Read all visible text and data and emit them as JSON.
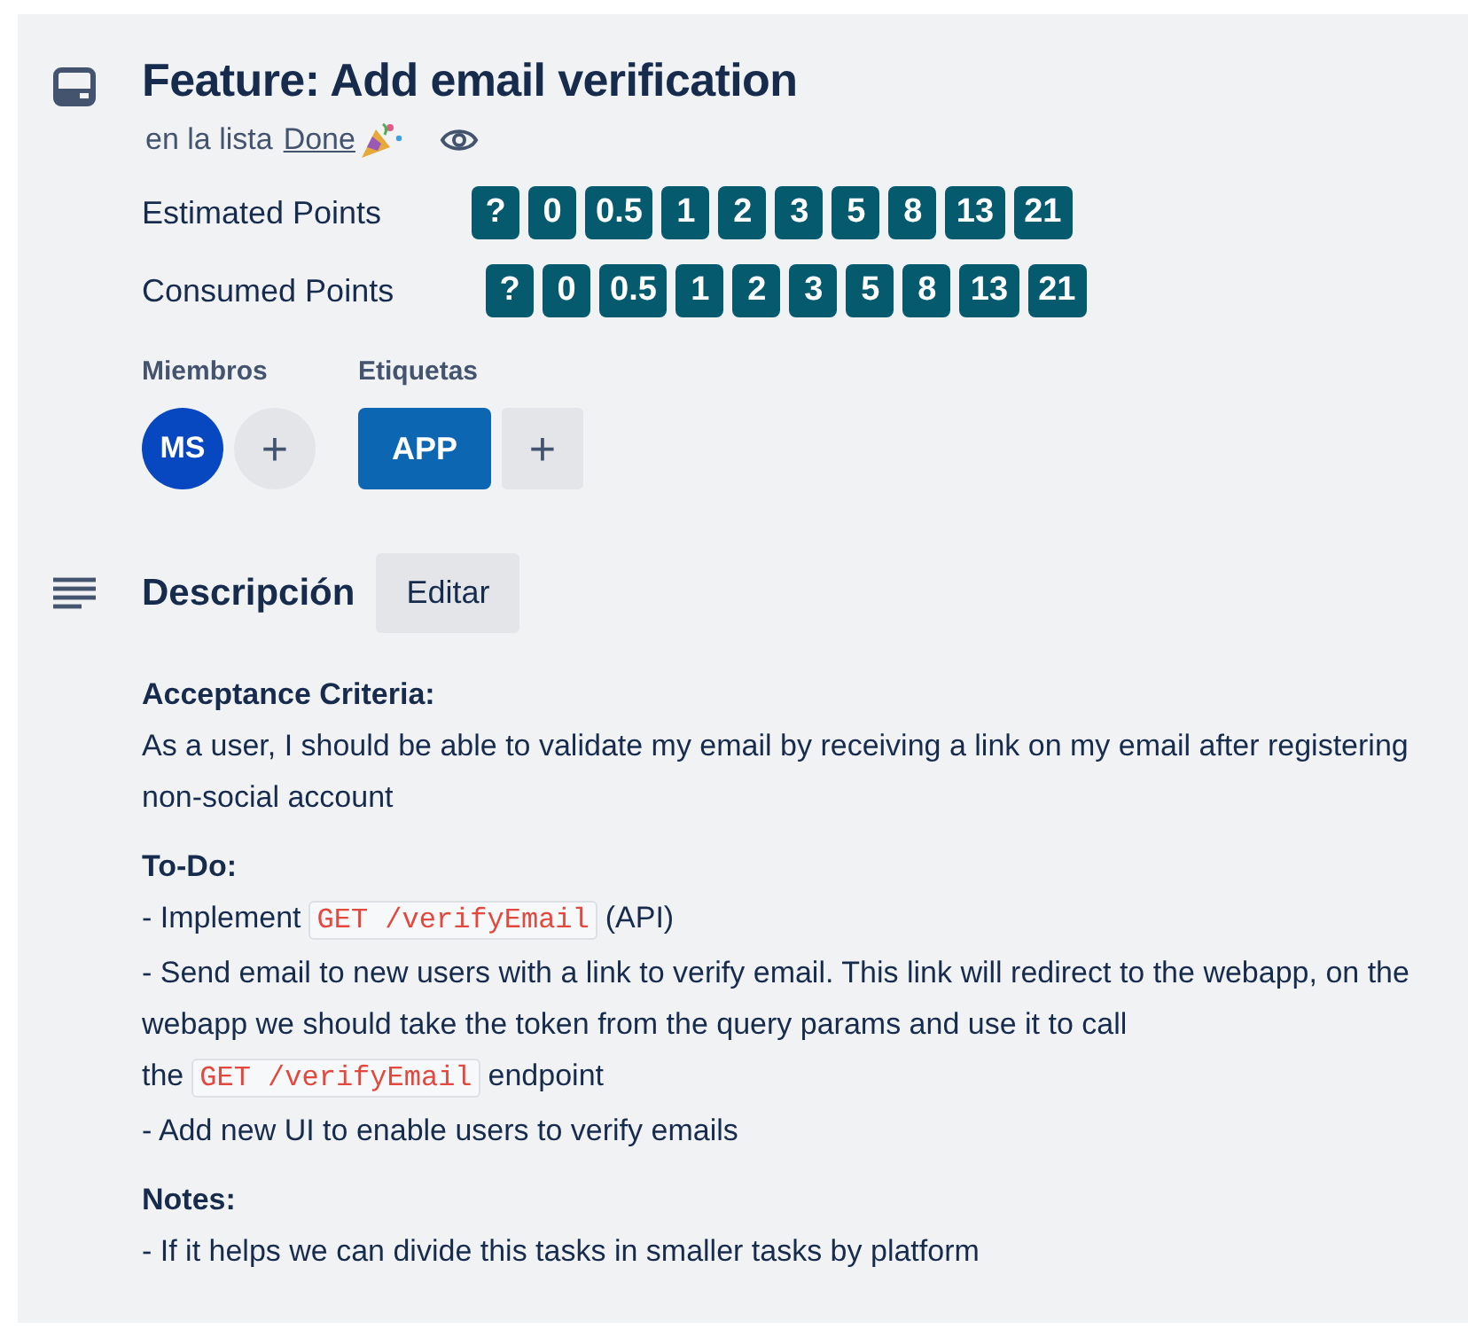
{
  "card": {
    "title": "Feature: Add email verification",
    "list_prefix": "en la lista",
    "list_name": "Done",
    "watching": true
  },
  "point_fields": [
    {
      "label": "Estimated Points",
      "options": [
        {
          "label": "?",
          "selected": false
        },
        {
          "label": "0",
          "selected": false
        },
        {
          "label": "0.5",
          "selected": false
        },
        {
          "label": "1",
          "selected": false
        },
        {
          "label": "2",
          "selected": false
        },
        {
          "label": "3",
          "selected": false
        },
        {
          "label": "5",
          "selected": false
        },
        {
          "label": "8",
          "selected": false
        },
        {
          "label": "13",
          "selected": false
        },
        {
          "label": "21",
          "selected": false
        }
      ]
    },
    {
      "label": "Consumed Points",
      "options": [
        {
          "label": "?",
          "selected": false
        },
        {
          "label": "0",
          "selected": false
        },
        {
          "label": "0.5",
          "selected": false
        },
        {
          "label": "1",
          "selected": false
        },
        {
          "label": "2",
          "selected": false
        },
        {
          "label": "3",
          "selected": false
        },
        {
          "label": "5",
          "selected": false
        },
        {
          "label": "8",
          "selected": false
        },
        {
          "label": "13",
          "selected": false
        },
        {
          "label": "21",
          "selected": false
        }
      ]
    }
  ],
  "members": {
    "heading": "Miembros",
    "avatars": [
      "MS"
    ],
    "add": "+"
  },
  "labels": {
    "heading": "Etiquetas",
    "items": [
      {
        "text": "APP",
        "color": "#0c66b2"
      }
    ],
    "add": "+"
  },
  "description": {
    "heading": "Descripción",
    "edit_button": "Editar",
    "blocks": [
      {
        "kind": "heading",
        "segments": [
          {
            "kind": "text",
            "text": "Acceptance Criteria:"
          }
        ]
      },
      {
        "kind": "line",
        "segments": [
          {
            "kind": "text",
            "text": "As a user, I should be able to validate my email by receiving a link on my email after registering non-social account"
          }
        ]
      },
      {
        "kind": "heading",
        "segments": [
          {
            "kind": "text",
            "text": "To-Do:"
          }
        ]
      },
      {
        "kind": "line",
        "segments": [
          {
            "kind": "text",
            "text": "- Implement"
          },
          {
            "kind": "code",
            "text": "GET /verifyEmail"
          },
          {
            "kind": "text",
            "text": "(API)"
          }
        ]
      },
      {
        "kind": "line",
        "segments": [
          {
            "kind": "text",
            "text": "- Send email to new users with a link to verify email. This link will redirect to the webapp, on the webapp we should take the token from the query params and use it to call the"
          },
          {
            "kind": "code",
            "text": "GET /verifyEmail"
          },
          {
            "kind": "text",
            "text": "endpoint"
          }
        ]
      },
      {
        "kind": "line",
        "segments": [
          {
            "kind": "text",
            "text": "- Add new UI to enable users to verify emails"
          }
        ]
      },
      {
        "kind": "heading",
        "segments": [
          {
            "kind": "text",
            "text": "Notes:"
          }
        ]
      },
      {
        "kind": "line",
        "segments": [
          {
            "kind": "text",
            "text": "- If it helps we can divide this tasks in smaller tasks by platform"
          }
        ]
      }
    ]
  }
}
